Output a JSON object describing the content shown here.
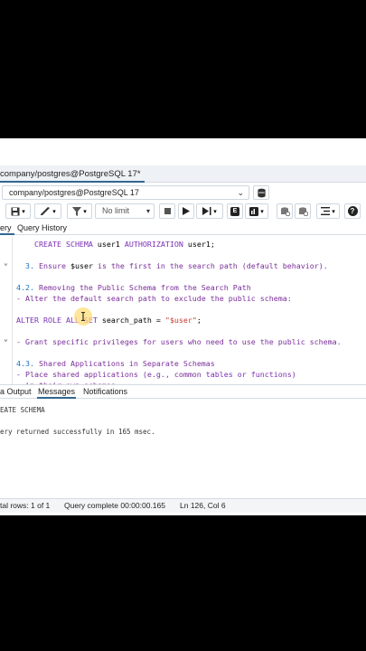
{
  "tab": {
    "title": "company/postgres@PostgreSQL 17*"
  },
  "connection": {
    "selected": "company/postgres@PostgreSQL 17"
  },
  "toolbar": {
    "limit_value": "No limit"
  },
  "query_tabs": {
    "query": "ery",
    "history": "Query History"
  },
  "editor": {
    "lines": [
      {
        "indent": "    ",
        "parts": [
          [
            "kw",
            "CREATE SCHEMA "
          ],
          [
            "",
            "user1 "
          ],
          [
            "kw",
            "AUTHORIZATION "
          ],
          [
            "",
            "user1;"
          ]
        ]
      },
      {
        "indent": "",
        "parts": []
      },
      {
        "indent": "  ",
        "parts": [
          [
            "num",
            "3. "
          ],
          [
            "cm",
            "Ensure "
          ],
          [
            "",
            "$user "
          ],
          [
            "cm",
            "is the first in the search path (default behavior)."
          ]
        ]
      },
      {
        "indent": "",
        "parts": []
      },
      {
        "indent": "",
        "parts": [
          [
            "num",
            "4.2. "
          ],
          [
            "cm",
            "Removing the Public Schema from the Search Path"
          ]
        ]
      },
      {
        "indent": "",
        "parts": [
          [
            "cm",
            "- Alter the default search path to exclude the public schema:"
          ]
        ]
      },
      {
        "indent": "",
        "parts": []
      },
      {
        "indent": "",
        "parts": [
          [
            "kw",
            "ALTER ROLE ALL SET "
          ],
          [
            "",
            "search_path = "
          ],
          [
            "str",
            "\"$user\""
          ],
          [
            "",
            ";"
          ]
        ]
      },
      {
        "indent": "",
        "parts": []
      },
      {
        "indent": "",
        "parts": [
          [
            "cm",
            "- Grant specific privileges for users who need to use the public schema."
          ]
        ]
      },
      {
        "indent": "",
        "parts": []
      },
      {
        "indent": "",
        "parts": [
          [
            "num",
            "4.3. "
          ],
          [
            "cm",
            "Shared Applications in Separate Schemas"
          ]
        ]
      },
      {
        "indent": "",
        "parts": [
          [
            "cm",
            "- Place shared applications (e.g., common "
          ],
          [
            "kw",
            "tables or functions"
          ],
          [
            "cm",
            ")"
          ]
        ]
      },
      {
        "indent": "  ",
        "parts": [
          [
            "cm",
            "in their own schemas."
          ]
        ]
      }
    ]
  },
  "result_tabs": {
    "data_output": "a Output",
    "messages": "Messages",
    "notifications": "Notifications"
  },
  "messages": {
    "line1": "EATE SCHEMA",
    "line2": "ery returned successfully in 165 msec."
  },
  "status": {
    "rows": "tal rows: 1 of 1",
    "query": "Query complete 00:00:00.165",
    "position": "Ln 126, Col 6"
  },
  "colors": {
    "accent": "#326690",
    "keyword": "#7b2fb5",
    "number": "#1d6fc2",
    "string": "#c0392b"
  },
  "icons": [
    "save-icon",
    "pen-icon",
    "filter-icon",
    "stop-icon",
    "play-icon",
    "explain-icon",
    "chart-icon",
    "commit-icon",
    "rollback-icon",
    "format-icon",
    "help-icon",
    "database-icon",
    "chevron-down-icon"
  ]
}
